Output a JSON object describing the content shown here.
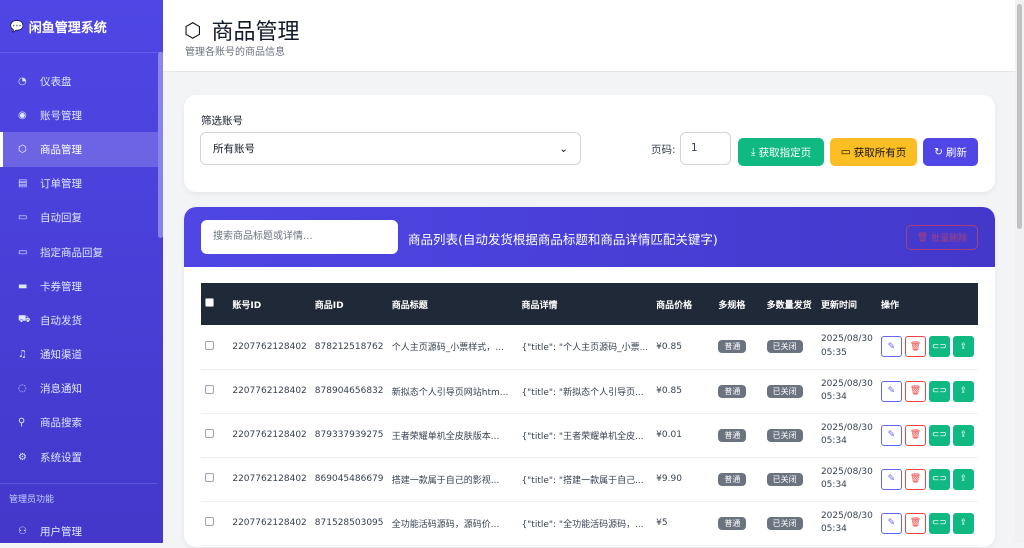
{
  "app": {
    "title": "闲鱼管理系统"
  },
  "sidebar": {
    "items": [
      {
        "label": "仪表盘",
        "icon": "dashboard-icon",
        "glyph": "◔"
      },
      {
        "label": "账号管理",
        "icon": "user-circle-icon",
        "glyph": "◉"
      },
      {
        "label": "商品管理",
        "icon": "box-icon",
        "glyph": "⬡"
      },
      {
        "label": "订单管理",
        "icon": "list-icon",
        "glyph": "▤"
      },
      {
        "label": "自动回复",
        "icon": "chat-icon",
        "glyph": "▭"
      },
      {
        "label": "指定商品回复",
        "icon": "chat-icon",
        "glyph": "▭"
      },
      {
        "label": "卡券管理",
        "icon": "card-icon",
        "glyph": "▬"
      },
      {
        "label": "自动发货",
        "icon": "truck-icon",
        "glyph": "⛟"
      },
      {
        "label": "通知渠道",
        "icon": "bell-icon",
        "glyph": "♫"
      },
      {
        "label": "消息通知",
        "icon": "message-icon",
        "glyph": "◌"
      },
      {
        "label": "商品搜索",
        "icon": "search-icon",
        "glyph": "⚲"
      },
      {
        "label": "系统设置",
        "icon": "gear-icon",
        "glyph": "⚙"
      }
    ],
    "admin_section": "管理员功能",
    "admin_items": [
      {
        "label": "用户管理",
        "icon": "users-icon",
        "glyph": "⚇"
      }
    ]
  },
  "header": {
    "title": "商品管理",
    "subtitle": "管理各账号的商品信息"
  },
  "filter": {
    "label": "筛选账号",
    "selected": "所有账号",
    "page_label": "页码:",
    "page_value": "1",
    "btn_fetch_page": "获取指定页",
    "btn_fetch_all": "获取所有页",
    "btn_refresh": "刷新"
  },
  "products": {
    "search_placeholder": "搜索商品标题或详情...",
    "title": "商品列表(自动发货根据商品标题和商品详情匹配关键字)",
    "batch_delete": "批量删除",
    "columns": [
      "账号ID",
      "商品ID",
      "商品标题",
      "商品详情",
      "商品价格",
      "多规格",
      "多数量发货",
      "更新时间",
      "操作"
    ],
    "rows": [
      {
        "account": "2207762128402",
        "id": "878212518762",
        "title": "个人主页源码_小票样式，...",
        "detail": "{\"title\": \"个人主页源码_小票...",
        "price": "¥0.85",
        "spec": "普通",
        "multi": "已关闭",
        "date": "2025/08/30",
        "time": "05:35"
      },
      {
        "account": "2207762128402",
        "id": "878904656832",
        "title": "新拟态个人引导页网站htm...",
        "detail": "{\"title\": \"新拟态个人引导页...",
        "price": "¥0.85",
        "spec": "普通",
        "multi": "已关闭",
        "date": "2025/08/30",
        "time": "05:34"
      },
      {
        "account": "2207762128402",
        "id": "879337939275",
        "title": "王者荣耀单机全皮肤版本...",
        "detail": "{\"title\": \"王者荣耀单机全皮...",
        "price": "¥0.01",
        "spec": "普通",
        "multi": "已关闭",
        "date": "2025/08/30",
        "time": "05:34"
      },
      {
        "account": "2207762128402",
        "id": "869045486679",
        "title": "搭建一款属于自己的影视...",
        "detail": "{\"title\": \"搭建一款属于自己...",
        "price": "¥9.90",
        "spec": "普通",
        "multi": "已关闭",
        "date": "2025/08/30",
        "time": "05:34"
      },
      {
        "account": "2207762128402",
        "id": "871528503095",
        "title": "全功能活码源码，源码价...",
        "detail": "{\"title\": \"全功能活码源码，...",
        "price": "¥5",
        "spec": "普通",
        "multi": "已关闭",
        "date": "2025/08/30",
        "time": "05:34"
      }
    ]
  }
}
